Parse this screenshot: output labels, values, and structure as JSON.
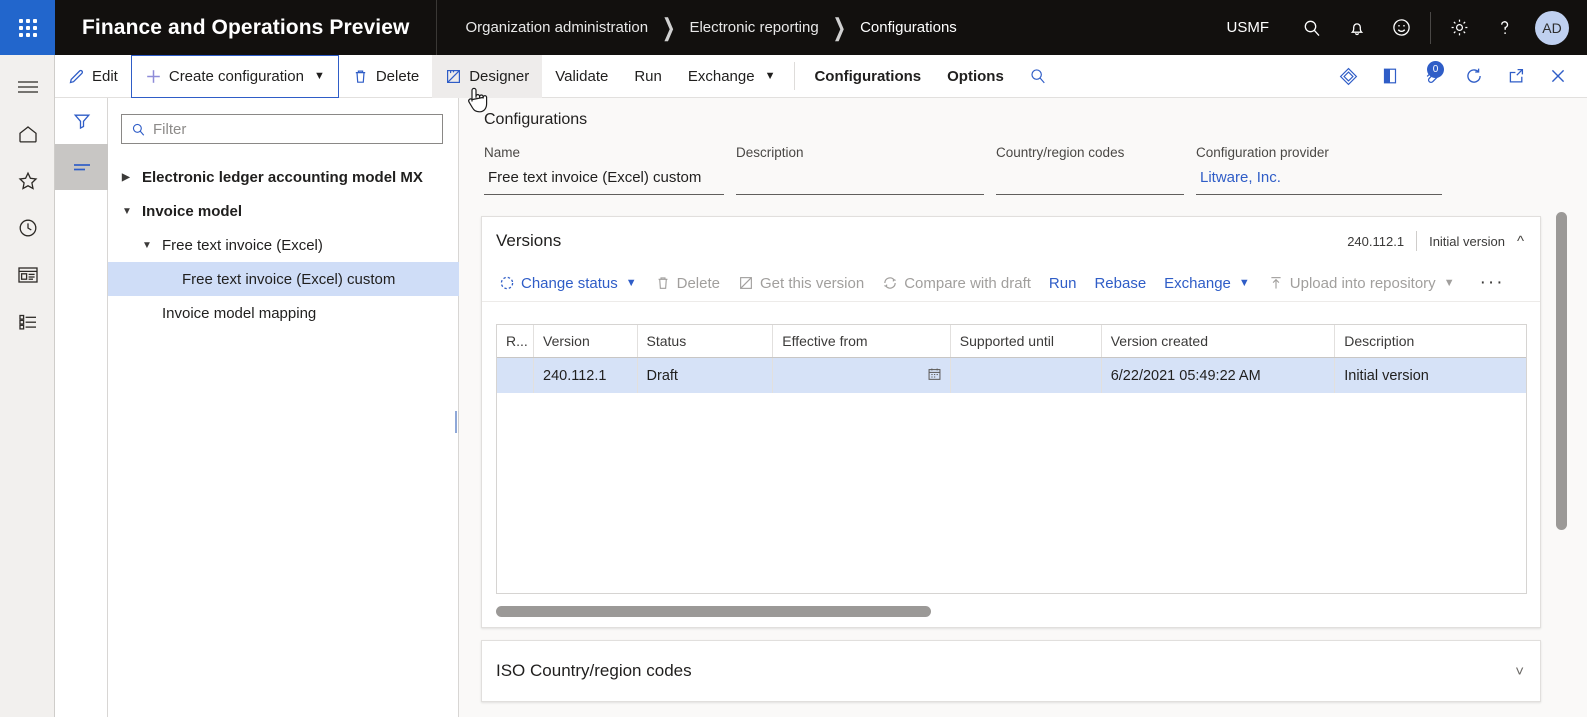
{
  "topbar": {
    "waffle_label": "app-launcher",
    "app_title": "Finance and Operations Preview",
    "breadcrumb": [
      "Organization administration",
      "Electronic reporting",
      "Configurations"
    ],
    "company": "USMF",
    "icons": [
      "search-icon",
      "notification-bell-icon",
      "feedback-smiley-icon",
      "settings-gear-icon",
      "help-question-icon"
    ],
    "avatar_initials": "AD"
  },
  "nav_rail": {
    "items": [
      "hamburger-menu-icon",
      "home-icon",
      "favorites-star-icon",
      "recent-clock-icon",
      "workspaces-icon",
      "modules-list-icon"
    ]
  },
  "command_bar": {
    "edit_label": "Edit",
    "create_label": "Create configuration",
    "delete_label": "Delete",
    "designer_label": "Designer",
    "validate_label": "Validate",
    "run_label": "Run",
    "exchange_label": "Exchange",
    "configurations_tab": "Configurations",
    "options_tab": "Options",
    "search_icon": "search-icon",
    "right_icons": [
      "personalize-diamond-icon",
      "fact-box-pane-icon",
      "attachments-icon",
      "refresh-icon",
      "open-in-new-window-icon",
      "close-icon"
    ],
    "attachments_count": "0"
  },
  "filter_rail": {
    "filter_icon": "filter-icon",
    "lines_icon": "sort-lines-icon"
  },
  "tree_pane": {
    "filter_placeholder": "Filter",
    "search_icon": "search-icon",
    "nodes": [
      {
        "label": "Electronic ledger accounting model MX",
        "level": 0,
        "expander": "collapsed",
        "selected": false
      },
      {
        "label": "Invoice model",
        "level": 0,
        "expander": "expanded",
        "selected": false
      },
      {
        "label": "Free text invoice (Excel)",
        "level": 1,
        "expander": "expanded",
        "selected": false
      },
      {
        "label": "Free text invoice (Excel) custom",
        "level": 2,
        "expander": "none",
        "selected": true
      },
      {
        "label": "Invoice model mapping",
        "level": 1,
        "expander": "none",
        "selected": false
      }
    ]
  },
  "content": {
    "page_heading": "Configurations",
    "fields": [
      {
        "label": "Name",
        "value": "Free text invoice (Excel) custom",
        "is_link": false
      },
      {
        "label": "Description",
        "value": "",
        "is_link": false
      },
      {
        "label": "Country/region codes",
        "value": "",
        "is_link": false
      },
      {
        "label": "Configuration provider",
        "value": "Litware, Inc.",
        "is_link": true
      }
    ],
    "versions_card": {
      "title": "Versions",
      "summary_version": "240.112.1",
      "summary_description": "Initial version",
      "collapse_caret": "chevron-up-icon",
      "actions": [
        {
          "label": "Change status",
          "icon": "status-circle-icon",
          "disabled": false,
          "dropdown": true
        },
        {
          "label": "Delete",
          "icon": "trash-icon",
          "disabled": true,
          "dropdown": false
        },
        {
          "label": "Get this version",
          "icon": "get-version-icon",
          "disabled": true,
          "dropdown": false
        },
        {
          "label": "Compare with draft",
          "icon": "compare-icon",
          "disabled": true,
          "dropdown": false
        },
        {
          "label": "Run",
          "icon": "",
          "disabled": false,
          "dropdown": false
        },
        {
          "label": "Rebase",
          "icon": "",
          "disabled": false,
          "dropdown": false
        },
        {
          "label": "Exchange",
          "icon": "",
          "disabled": false,
          "dropdown": true
        },
        {
          "label": "Upload into repository",
          "icon": "upload-icon",
          "disabled": true,
          "dropdown": true
        }
      ],
      "overflow_label": "···",
      "columns": [
        "R...",
        "Version",
        "Status",
        "Effective from",
        "Supported until",
        "Version created",
        "Description"
      ],
      "rows": [
        {
          "R...": "",
          "Version": "240.112.1",
          "Status": "Draft",
          "Effective from": "",
          "Supported until": "",
          "Version created": "6/22/2021 05:49:22 AM",
          "Description": "Initial version",
          "selected": true,
          "date_picker_icon": "calendar-icon"
        }
      ]
    },
    "iso_card": {
      "title": "ISO Country/region codes",
      "caret": "chevron-down-icon"
    }
  }
}
